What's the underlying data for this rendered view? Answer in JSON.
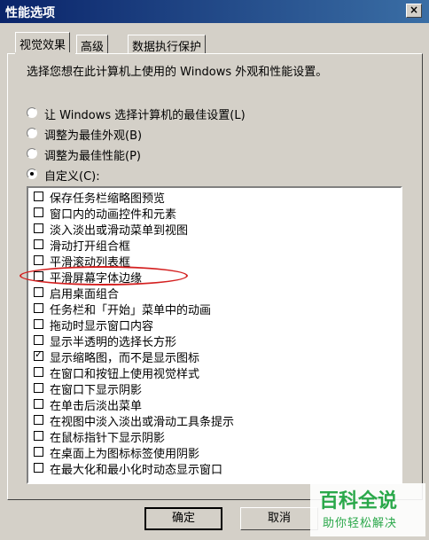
{
  "window": {
    "title": "性能选项",
    "close_glyph": "×"
  },
  "tabs": [
    {
      "label": "视觉效果",
      "active": true
    },
    {
      "label": "高级",
      "active": false
    },
    {
      "label": "数据执行保护",
      "active": false
    }
  ],
  "description": "选择您想在此计算机上使用的 Windows 外观和性能设置。",
  "radio_options": [
    {
      "label": "让 Windows 选择计算机的最佳设置(L)",
      "checked": false
    },
    {
      "label": "调整为最佳外观(B)",
      "checked": false
    },
    {
      "label": "调整为最佳性能(P)",
      "checked": false
    },
    {
      "label": "自定义(C):",
      "checked": true
    }
  ],
  "effects": [
    {
      "label": "保存任务栏缩略图预览",
      "checked": false
    },
    {
      "label": "窗口内的动画控件和元素",
      "checked": false
    },
    {
      "label": "淡入淡出或滑动菜单到视图",
      "checked": false
    },
    {
      "label": "滑动打开组合框",
      "checked": false
    },
    {
      "label": "平滑滚动列表框",
      "checked": false
    },
    {
      "label": "平滑屏幕字体边缘",
      "checked": false
    },
    {
      "label": "启用桌面组合",
      "checked": false
    },
    {
      "label": "任务栏和「开始」菜单中的动画",
      "checked": false
    },
    {
      "label": "拖动时显示窗口内容",
      "checked": false
    },
    {
      "label": "显示半透明的选择长方形",
      "checked": false
    },
    {
      "label": "显示缩略图，而不是显示图标",
      "checked": true
    },
    {
      "label": "在窗口和按钮上使用视觉样式",
      "checked": false
    },
    {
      "label": "在窗口下显示阴影",
      "checked": false
    },
    {
      "label": "在单击后淡出菜单",
      "checked": false
    },
    {
      "label": "在视图中淡入淡出或滑动工具条提示",
      "checked": false
    },
    {
      "label": "在鼠标指针下显示阴影",
      "checked": false
    },
    {
      "label": "在桌面上为图标标签使用阴影",
      "checked": false
    },
    {
      "label": "在最大化和最小化时动态显示窗口",
      "checked": false
    }
  ],
  "buttons": {
    "ok": "确定",
    "cancel": "取消"
  },
  "watermark": {
    "title": "百科全说",
    "subtitle": "助你轻松解决"
  },
  "colors": {
    "titlebar": "#0a246a",
    "dialog": "#d4d0c8",
    "highlight_ellipse": "#d42020",
    "watermark": "#2aa84a"
  }
}
